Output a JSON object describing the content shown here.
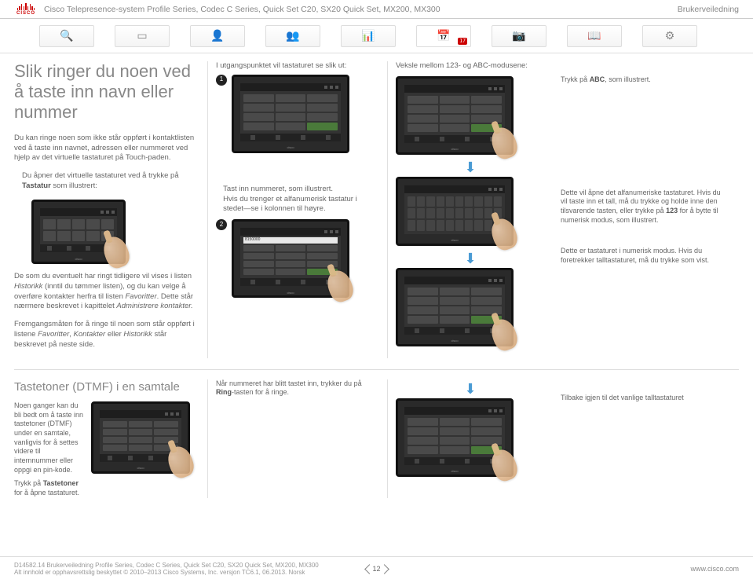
{
  "header": {
    "product_line": "Cisco Telepresence-system Profile Series, Codec C Series, Quick Set C20, SX20 Quick Set, MX200, MX300",
    "doc_type": "Brukerveiledning",
    "cisco": "CISCO"
  },
  "nav": {
    "calendar_badge": "17"
  },
  "col1": {
    "title": "Slik ringer du noen ved å taste inn navn eller nummer",
    "p1": "Du kan ringe noen som ikke står oppført i kontaktlisten ved å taste inn navnet, adressen eller nummeret ved hjelp av det virtuelle tastaturet på Touch-paden.",
    "p2a": "Du åpner det virtuelle tastaturet ved å trykke på ",
    "p2b": "Tastatur",
    "p2c": " som illustrert:",
    "p3a": "De som du eventuelt har ringt tidligere vil vises i listen ",
    "p3b": "Historikk",
    "p3c": " (inntil du tømmer listen), og du kan velge å overføre kontakter herfra til listen ",
    "p3d": "Favoritter",
    "p3e": ". Dette står nærmere beskrevet i kapittelet ",
    "p3f": "Administrere kontakter.",
    "p4a": "Fremgangsmåten for å ringe til noen som står oppført i listene ",
    "p4b": "Favoritter",
    "p4c": ", ",
    "p4d": "Kontakter",
    "p4e": " eller ",
    "p4f": "Historikk",
    "p4g": " står beskrevet på neste side."
  },
  "col2": {
    "intro": "I utgangspunktet vil tastaturet se slik ut:",
    "step1": "1",
    "step2_label_a": "Tast inn nummeret, som illustrert.",
    "step2_label_b": "Hvis du trenger et alfanumerisk tastatur i stedet—se i kolonnen til høyre.",
    "step2": "2",
    "dial_value": "8150000"
  },
  "col3": {
    "heading": "Veksle mellom 123- og ABC-modusene:"
  },
  "col4": {
    "r1a": "Trykk på ",
    "r1b": "ABC",
    "r1c": ", som illustrert.",
    "r2a": "Dette vil åpne det alfanumeriske tastaturet. Hvis du vil taste inn et tall, må du trykke og holde inne den tilsvarende tasten, eller trykke på ",
    "r2b": "123",
    "r2c": " for å bytte til numerisk modus, som illustrert.",
    "r3": "Dette er tastaturet i numerisk modus. Hvis du foretrekker talltastaturet, må du trykke som vist."
  },
  "sec2": {
    "title": "Tastetoner (DTMF) i en samtale",
    "p1": "Noen ganger kan du bli bedt om å taste inn tastetoner (DTMF) under en samtale, vanligvis for å settes videre til internnummer eller oppgi en pin-kode.",
    "p2a": "Trykk på ",
    "p2b": "Tastetoner",
    "p2c": " for å åpne tastaturet.",
    "c2a": "Når nummeret har blitt tastet inn, trykker du på ",
    "c2b": "Ring",
    "c2c": "-tasten for å ringe.",
    "c4": "Tilbake igjen til det vanlige talltastaturet"
  },
  "footer": {
    "line1": "D14582.14 Brukerveiledning Profile Series, Codec C Series, Quick Set C20, SX20 Quick Set, MX200, MX300",
    "line2": "Alt innhold er opphavsrettslig beskyttet © 2010–2013 Cisco Systems, Inc. versjon TC6.1, 06.2013. Norsk",
    "page": "12",
    "url": "www.cisco.com"
  }
}
